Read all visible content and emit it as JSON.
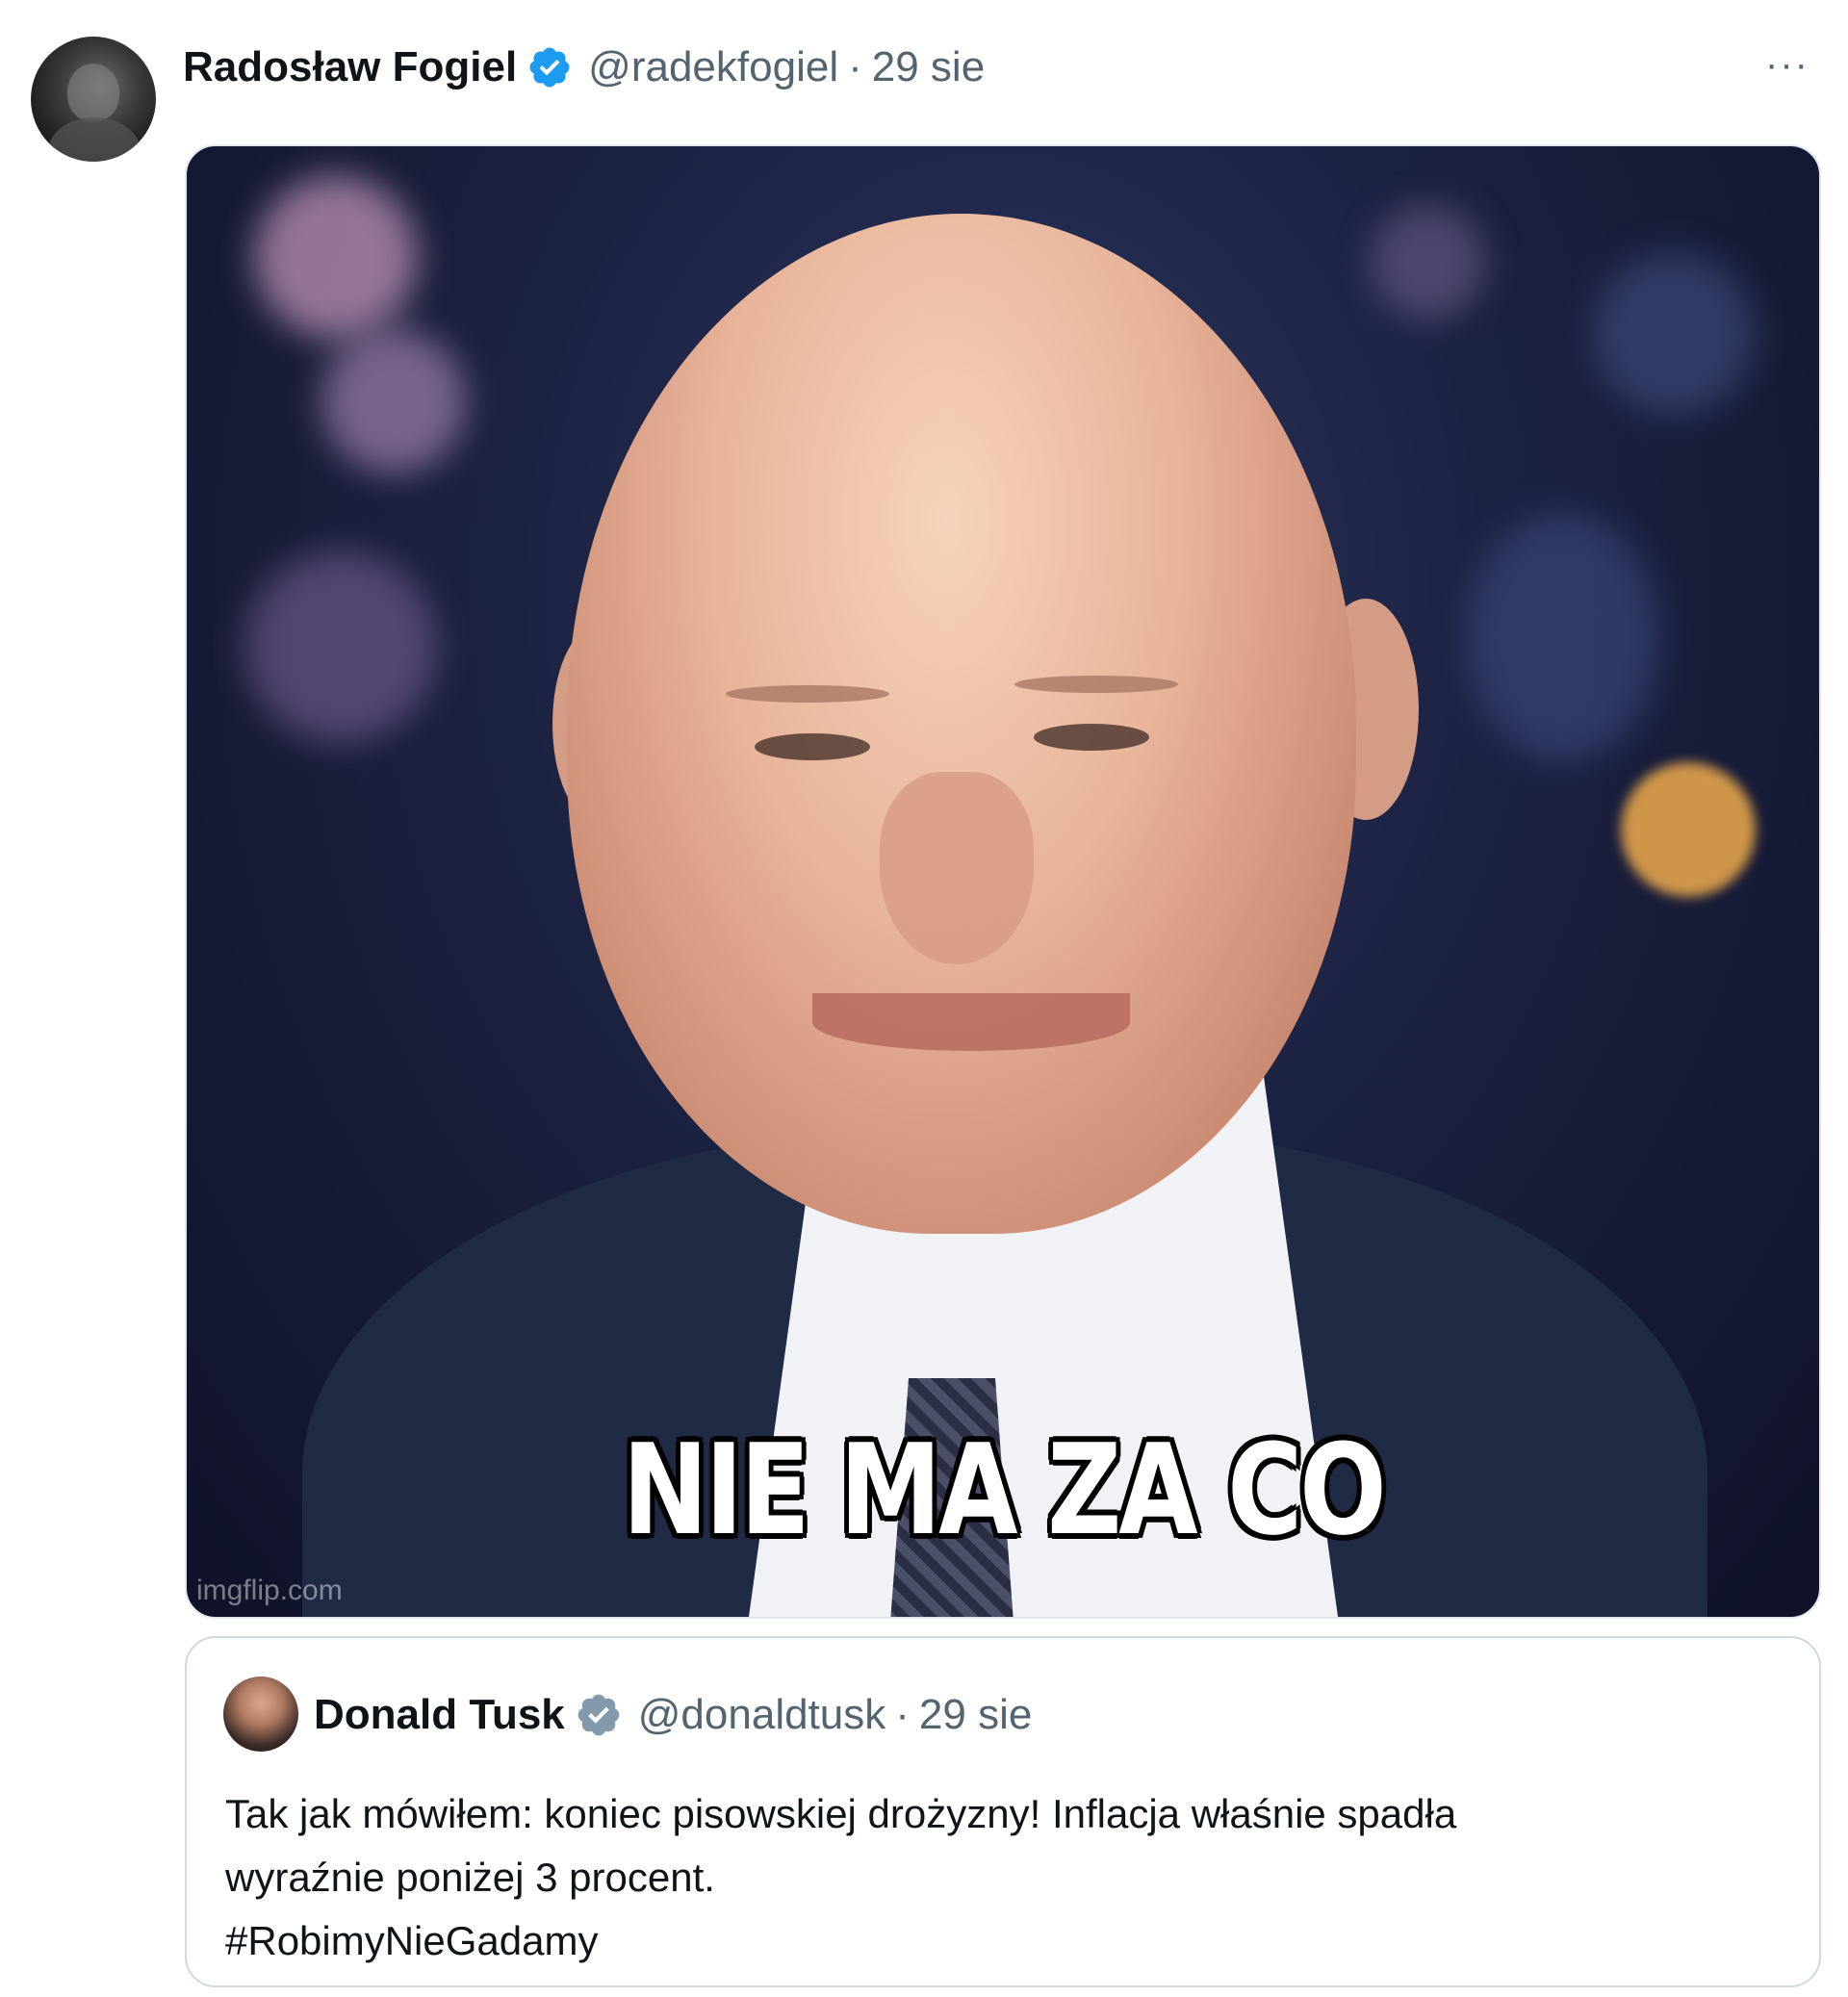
{
  "tweet": {
    "author": {
      "name": "Radosław Fogiel",
      "handle": "@radekfogiel",
      "separator": "·",
      "time": "29 sie",
      "verified_icon": "verified-badge-icon"
    },
    "more_icon": "···",
    "media": {
      "meme_caption": "NIE MA ZA CO",
      "watermark": "imgflip.com"
    },
    "quote": {
      "author": {
        "name": "Donald Tusk",
        "handle": "@donaldtusk",
        "separator": "·",
        "time": "29 sie",
        "verified_icon": "verified-badge-icon"
      },
      "text_lines": [
        "Tak jak mówiłem: koniec pisowskiej drożyzny! Inflacja właśnie spadła",
        "wyraźnie poniżej 3 procent.",
        "#RobimyNieGadamy"
      ]
    }
  },
  "colors": {
    "verified_blue": "#1d9bf0",
    "verified_gray": "#829aab",
    "secondary_text": "#536471",
    "primary_text": "#0f1419",
    "border": "#cfd9de"
  }
}
